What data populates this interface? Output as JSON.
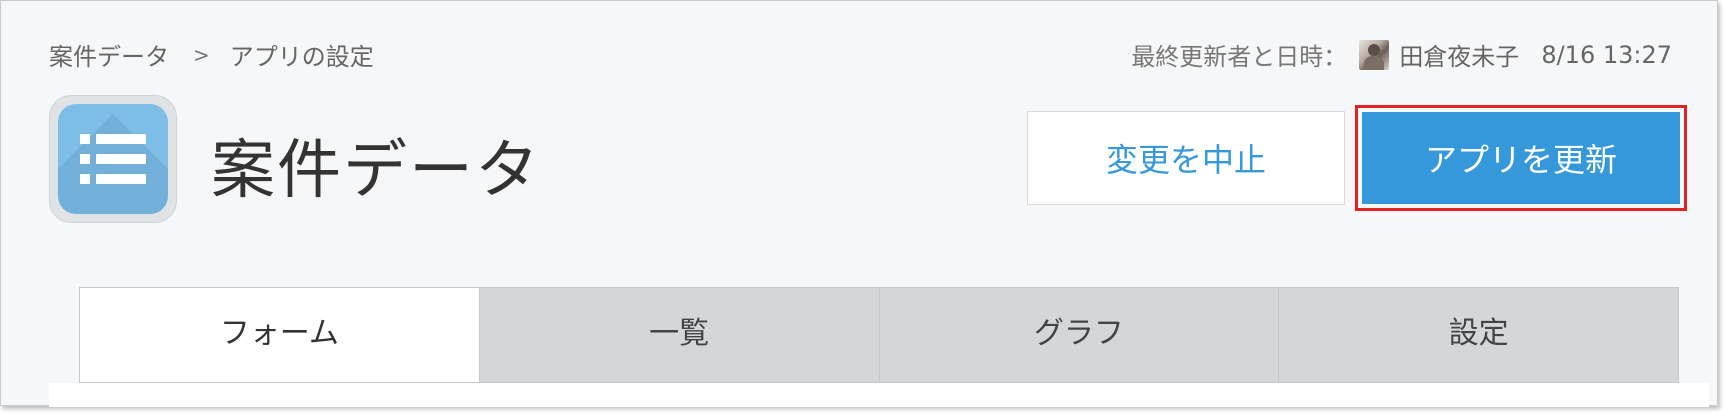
{
  "breadcrumb": {
    "items": [
      "案件データ",
      "アプリの設定"
    ],
    "separator": ">"
  },
  "last_updated": {
    "label": "最終更新者と日時：",
    "user": "田倉夜未子",
    "time": "8/16 13:27"
  },
  "app": {
    "icon": "list-icon",
    "title": "案件データ"
  },
  "actions": {
    "cancel_label": "変更を中止",
    "update_label": "アプリを更新"
  },
  "tabs": [
    {
      "label": "フォーム",
      "active": true
    },
    {
      "label": "一覧",
      "active": false
    },
    {
      "label": "グラフ",
      "active": false
    },
    {
      "label": "設定",
      "active": false
    }
  ],
  "colors": {
    "accent": "#3498db",
    "highlight": "#e3231f",
    "tab_inactive": "#d3d7d9",
    "background": "#f5f7f8"
  }
}
